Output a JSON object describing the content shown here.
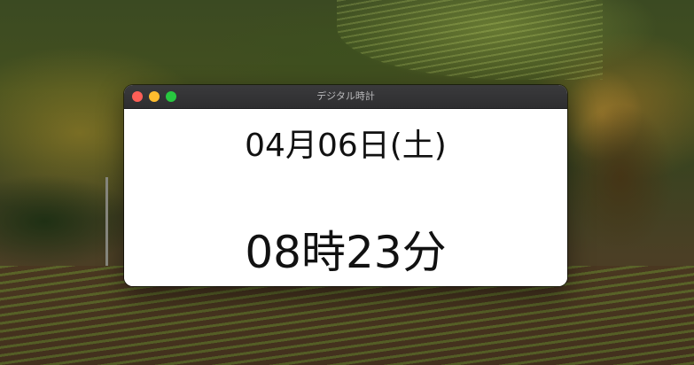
{
  "window": {
    "title": "デジタル時計"
  },
  "clock": {
    "date": "04月06日(土)",
    "time": "08時23分"
  },
  "colors": {
    "close": "#ff5f57",
    "minimize": "#febc2e",
    "zoom": "#28c840",
    "titlebar": "#2e2e30",
    "content_background": "#ffffff",
    "text": "#111111"
  }
}
